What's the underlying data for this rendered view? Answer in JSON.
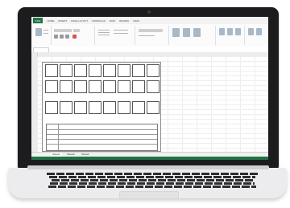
{
  "excel": {
    "file_tab": "FILE",
    "tabs": [
      "HOME",
      "INSERT",
      "PAGE LAYOUT",
      "FORMULAS",
      "DATA",
      "REVIEW",
      "VIEW"
    ],
    "name_box": "",
    "sheet_tabs": [
      "Sheet1",
      "Sheet2",
      "Sheet3"
    ],
    "accent_color": "#217346"
  },
  "device": {
    "frame_color": "#1c1c1e",
    "base_color": "#ececee"
  }
}
